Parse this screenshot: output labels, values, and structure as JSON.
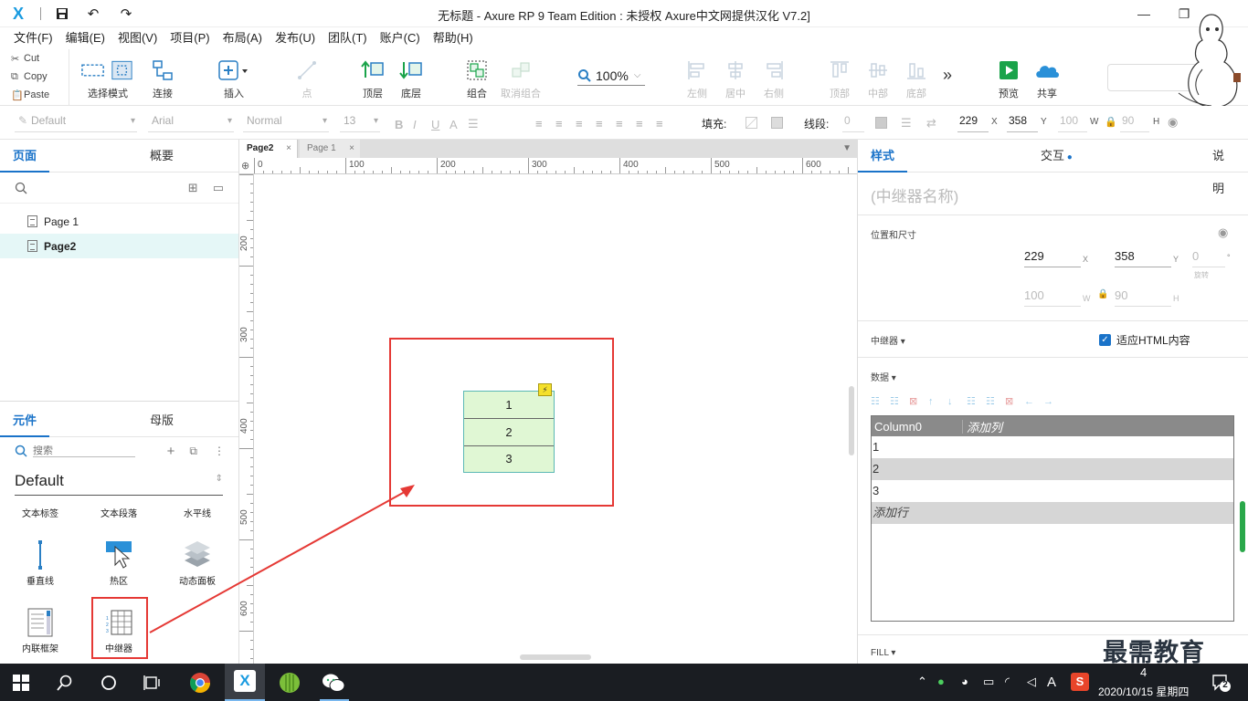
{
  "window": {
    "title": "无标题 - Axure RP 9 Team Edition : 未授权    Axure中文网提供汉化 V7.2]",
    "logo": "X"
  },
  "menu": [
    "文件(F)",
    "编辑(E)",
    "视图(V)",
    "项目(P)",
    "布局(A)",
    "发布(U)",
    "团队(T)",
    "账户(C)",
    "帮助(H)"
  ],
  "clipboard": {
    "cut": "Cut",
    "copy": "Copy",
    "paste": "Paste"
  },
  "toolbar": {
    "select_mode": "选择模式",
    "connect": "连接",
    "insert": "插入",
    "point": "点",
    "top_layer": "顶层",
    "bottom_layer": "底层",
    "group": "组合",
    "ungroup": "取消组合",
    "zoom": "100%",
    "align_left": "左侧",
    "align_center": "居中",
    "align_right": "右侧",
    "align_top": "顶部",
    "align_middle": "中部",
    "align_bottom": "底部",
    "more": "»",
    "preview": "预览",
    "share": "共享"
  },
  "format": {
    "style": "Default",
    "font": "Arial",
    "weight": "Normal",
    "size": "13",
    "fill_label": "填充:",
    "stroke_label": "线段:",
    "stroke_value": "0",
    "x": "229",
    "y": "358",
    "w": "100",
    "h": "90",
    "x_unit": "X",
    "y_unit": "Y",
    "w_unit": "W",
    "h_unit": "H"
  },
  "pages_panel": {
    "tab_pages": "页面",
    "tab_outline": "概要",
    "pages": [
      "Page 1",
      "Page2"
    ]
  },
  "widgets_panel": {
    "tab_widgets": "元件",
    "tab_masters": "母版",
    "search_placeholder": "搜索",
    "library": "Default",
    "items": [
      "文本标签",
      "文本段落",
      "水平线",
      "垂直线",
      "热区",
      "动态面板",
      "内联框架",
      "中继器"
    ]
  },
  "doc_tabs": [
    "Page2",
    "Page 1"
  ],
  "ruler": {
    "h": [
      "0",
      "100",
      "200",
      "300",
      "400",
      "500",
      "600"
    ],
    "v": [
      "200",
      "300",
      "400",
      "500",
      "600"
    ]
  },
  "repeater": {
    "rows": [
      "1",
      "2",
      "3"
    ]
  },
  "inspector": {
    "tab_style": "样式",
    "tab_interact": "交互",
    "tab_notes": "说明",
    "name_placeholder": "(中继器名称)",
    "pos_size_label": "位置和尺寸",
    "x": "229",
    "y": "358",
    "rotation": "0",
    "rotation_label": "旋转",
    "w": "100",
    "h": "90",
    "x_unit": "X",
    "y_unit": "Y",
    "w_unit": "W",
    "h_unit": "H",
    "deg": "°",
    "repeater_label": "中继器 ▾",
    "fit_html": "适应HTML内容",
    "data_label": "数据 ▾",
    "table_header": [
      "Column0",
      "添加列"
    ],
    "table_rows": [
      "1",
      "2",
      "3"
    ],
    "add_row": "添加行",
    "fill_label": "FILL ▾"
  },
  "taskbar": {
    "datetime": "2020/10/15 星期四",
    "notif": "2",
    "lang": "A",
    "time_partial": "4"
  },
  "watermark": "最需教育",
  "colors": {
    "accent": "#1a73c9",
    "highlight_red": "#e53935",
    "repeater_fill": "#e0f7d4",
    "repeater_border": "#5bb8b4",
    "taskbar": "#1a1d22"
  }
}
